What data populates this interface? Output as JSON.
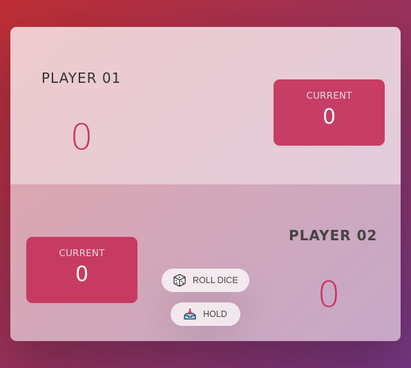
{
  "player1": {
    "name": "PLAYER 01",
    "score": "0",
    "current_label": "CURRENT",
    "current_score": "0"
  },
  "player2": {
    "name": "PLAYER 02",
    "score": "0",
    "current_label": "CURRENT",
    "current_score": "0"
  },
  "controls": {
    "roll_label": "ROLL DICE",
    "roll_icon": "dice-icon",
    "hold_label": "HOLD",
    "hold_icon": "inbox-tray-icon"
  },
  "colors": {
    "accent": "#c7365f",
    "background_from": "#bf2e34",
    "background_to": "#753682"
  }
}
